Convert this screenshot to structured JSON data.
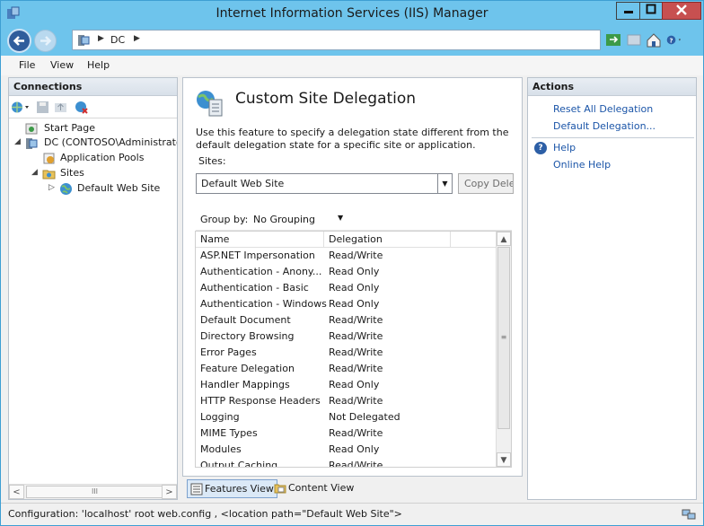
{
  "window": {
    "title": "Internet Information Services (IIS) Manager",
    "accent": "#6ec4ec"
  },
  "address": {
    "path": "DC"
  },
  "menu": [
    "File",
    "View",
    "Help"
  ],
  "connections": {
    "title": "Connections",
    "tree": [
      {
        "label": "Start Page",
        "icon": "start-page-icon"
      },
      {
        "label": "DC (CONTOSO\\Administrator)",
        "icon": "server-icon"
      },
      {
        "label": "Application Pools",
        "icon": "app-pools-icon"
      },
      {
        "label": "Sites",
        "icon": "sites-folder-icon"
      },
      {
        "label": "Default Web Site",
        "icon": "globe-icon"
      }
    ],
    "scroll_thumb": "III"
  },
  "main": {
    "title": "Custom Site Delegation",
    "description": "Use this feature to specify a delegation state different from the default delegation state for a specific site or application.",
    "sites_label": "Sites:",
    "sites_value": "Default Web Site",
    "copy_button": "Copy Delegation",
    "group_by_label": "Group by:",
    "group_by_value": "No Grouping",
    "columns": [
      "Name",
      "Delegation"
    ],
    "rows": [
      {
        "name": "ASP.NET Impersonation",
        "delegation": "Read/Write"
      },
      {
        "name": "Authentication - Anony...",
        "delegation": "Read Only"
      },
      {
        "name": "Authentication - Basic",
        "delegation": "Read Only"
      },
      {
        "name": "Authentication - Windows",
        "delegation": "Read Only"
      },
      {
        "name": "Default Document",
        "delegation": "Read/Write"
      },
      {
        "name": "Directory Browsing",
        "delegation": "Read/Write"
      },
      {
        "name": "Error Pages",
        "delegation": "Read/Write"
      },
      {
        "name": "Feature Delegation",
        "delegation": "Read/Write"
      },
      {
        "name": "Handler Mappings",
        "delegation": "Read Only"
      },
      {
        "name": "HTTP Response Headers",
        "delegation": "Read/Write"
      },
      {
        "name": "Logging",
        "delegation": "Not Delegated"
      },
      {
        "name": "MIME Types",
        "delegation": "Read/Write"
      },
      {
        "name": "Modules",
        "delegation": "Read Only"
      },
      {
        "name": "Output Caching",
        "delegation": "Read/Write"
      }
    ]
  },
  "view_tabs": [
    "Features View",
    "Content View"
  ],
  "actions": {
    "title": "Actions",
    "links": [
      "Reset All Delegation",
      "Default Delegation..."
    ],
    "help": [
      "Help",
      "Online Help"
    ]
  },
  "status": "Configuration: 'localhost' root web.config , <location path=\"Default Web Site\">"
}
